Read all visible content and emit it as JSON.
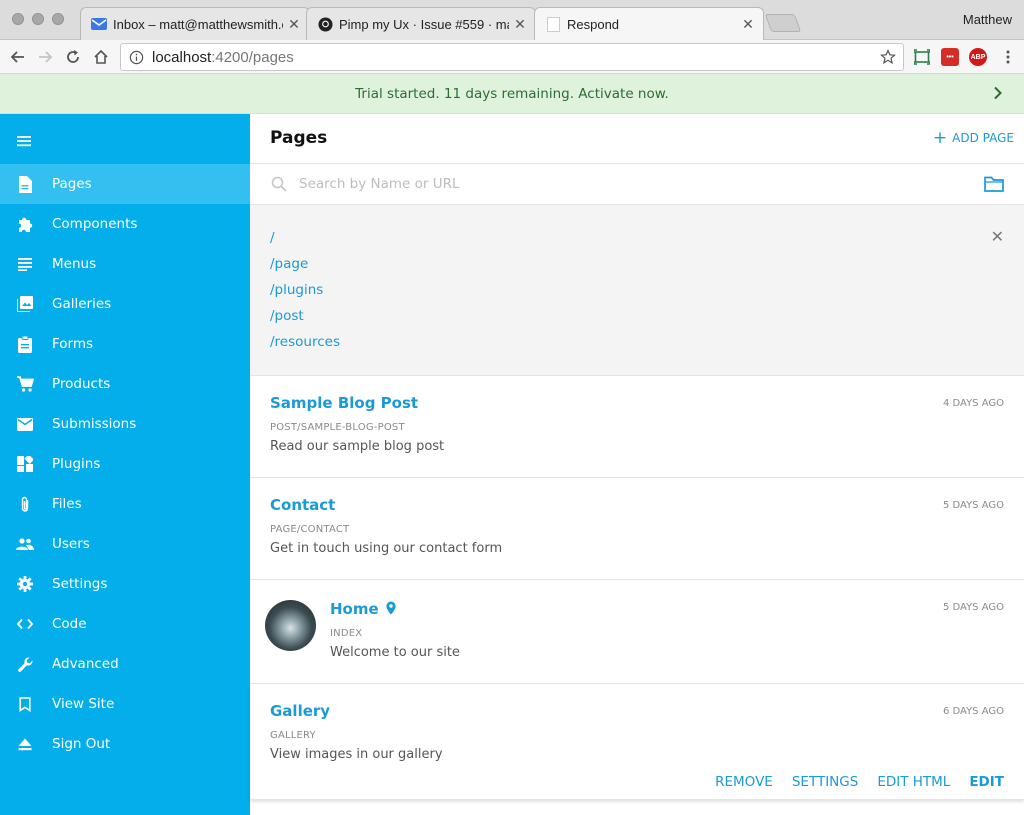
{
  "browser": {
    "tabs": [
      {
        "title": "Inbox – matt@matthewsmith.c",
        "icon": "mail-icon"
      },
      {
        "title": "Pimp my Ux · Issue #559 · mad",
        "icon": "github-icon"
      },
      {
        "title": "Respond",
        "icon": "blank-page-icon"
      }
    ],
    "profile_name": "Matthew",
    "url_host": "localhost",
    "url_path": ":4200/pages",
    "extensions": [
      "lastpass-icon",
      "adblock-icon"
    ]
  },
  "banner": {
    "text": "Trial started. 11 days remaining. Activate now."
  },
  "sidebar": {
    "color": "#03aeea",
    "items": [
      {
        "label": "Pages",
        "icon": "page-icon"
      },
      {
        "label": "Components",
        "icon": "puzzle-icon"
      },
      {
        "label": "Menus",
        "icon": "menu-lines-icon"
      },
      {
        "label": "Galleries",
        "icon": "gallery-icon"
      },
      {
        "label": "Forms",
        "icon": "clipboard-icon"
      },
      {
        "label": "Products",
        "icon": "cart-icon"
      },
      {
        "label": "Submissions",
        "icon": "envelope-icon"
      },
      {
        "label": "Plugins",
        "icon": "dashboard-icon"
      },
      {
        "label": "Files",
        "icon": "paperclip-icon"
      },
      {
        "label": "Users",
        "icon": "users-icon"
      },
      {
        "label": "Settings",
        "icon": "gear-icon"
      },
      {
        "label": "Code",
        "icon": "code-icon"
      },
      {
        "label": "Advanced",
        "icon": "wrench-icon"
      },
      {
        "label": "View Site",
        "icon": "bookmark-icon"
      },
      {
        "label": "Sign Out",
        "icon": "eject-icon"
      }
    ]
  },
  "main": {
    "title": "Pages",
    "add_label": "ADD PAGE",
    "search_placeholder": "Search by Name or URL",
    "paths": [
      "/",
      "/page",
      "/plugins",
      "/post",
      "/resources"
    ],
    "pages": [
      {
        "title": "Sample Blog Post",
        "url": "POST/SAMPLE-BLOG-POST",
        "description": "Read our sample blog post",
        "time": "4 DAYS AGO"
      },
      {
        "title": "Contact",
        "url": "PAGE/CONTACT",
        "description": "Get in touch using our contact form",
        "time": "5 DAYS AGO"
      },
      {
        "title": "Home",
        "url": "INDEX",
        "description": "Welcome to our site",
        "time": "5 DAYS AGO"
      },
      {
        "title": "Gallery",
        "url": "GALLERY",
        "description": "View images in our gallery",
        "time": "6 DAYS AGO"
      }
    ],
    "actions": {
      "remove": "REMOVE",
      "settings": "SETTINGS",
      "edit_html": "EDIT HTML",
      "edit": "EDIT"
    }
  }
}
